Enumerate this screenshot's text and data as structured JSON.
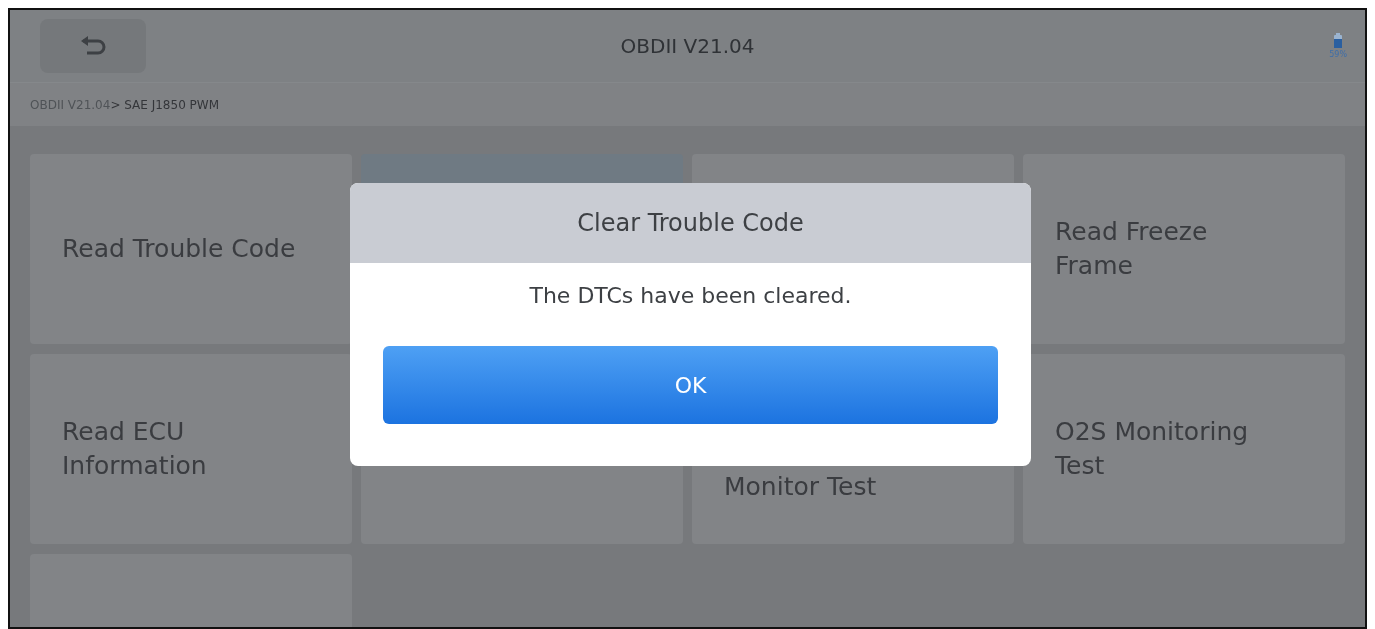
{
  "header": {
    "title": "OBDII V21.04",
    "battery": "59%"
  },
  "breadcrumb": [
    {
      "label": "OBDII V21.04",
      "current": false
    },
    {
      "label": "> SAE J1850 PWM",
      "current": true
    }
  ],
  "tiles": [
    {
      "label": "Read Trouble Code",
      "selected": false
    },
    {
      "selected": true
    },
    {
      "selected": false
    },
    {
      "label": "Read Freeze Frame",
      "selected": false
    },
    {
      "label": "Read ECU Information",
      "selected": false
    },
    {
      "selected": false
    },
    {
      "label": "Monitor Test",
      "selected": false
    },
    {
      "label": "O2S Monitoring Test",
      "selected": false
    },
    {
      "selected": false
    }
  ],
  "dialog": {
    "title": "Clear Trouble Code",
    "message": "The DTCs have been cleared.",
    "button": "OK"
  }
}
